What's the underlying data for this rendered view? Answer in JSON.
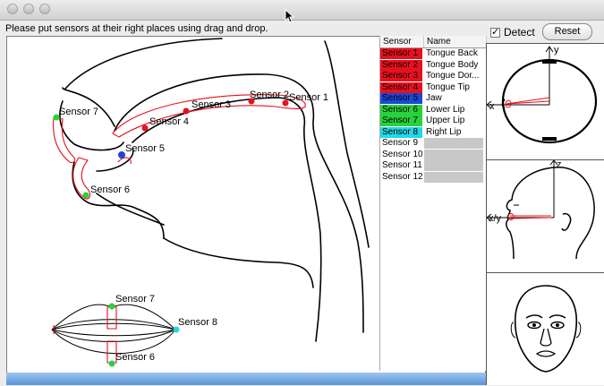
{
  "instruction": "Please put sensors at their right places using drag and drop.",
  "table": {
    "header_sensor": "Sensor",
    "header_name": "Name",
    "rows": [
      {
        "sensor": "Sensor 1",
        "name": "Tongue Back",
        "color": "#e8101e"
      },
      {
        "sensor": "Sensor 2",
        "name": "Tongue Body",
        "color": "#e8101e"
      },
      {
        "sensor": "Sensor 3",
        "name": "Tongue Dor...",
        "color": "#e8101e"
      },
      {
        "sensor": "Sensor 4",
        "name": "Tongue Tip",
        "color": "#e8101e"
      },
      {
        "sensor": "Sensor 5",
        "name": "Jaw",
        "color": "#1a49d6"
      },
      {
        "sensor": "Sensor 6",
        "name": "Lower Lip",
        "color": "#28d23c"
      },
      {
        "sensor": "Sensor 7",
        "name": "Upper Lip",
        "color": "#28d23c"
      },
      {
        "sensor": "Sensor 8",
        "name": "Right Lip",
        "color": "#22d8e8"
      },
      {
        "sensor": "Sensor 9",
        "name": "",
        "color": ""
      },
      {
        "sensor": "Sensor 10",
        "name": "",
        "color": ""
      },
      {
        "sensor": "Sensor 11",
        "name": "",
        "color": ""
      },
      {
        "sensor": "Sensor 12",
        "name": "",
        "color": ""
      }
    ]
  },
  "detect": {
    "label": "Detect",
    "checked": true
  },
  "reset_label": "Reset",
  "sagittal_labels": {
    "s1": "Sensor 1",
    "s2": "Sensor 2",
    "s3": "Sensor 3",
    "s4": "Sensor 4",
    "s5": "Sensor 5",
    "s6": "Sensor 6",
    "s7": "Sensor 7"
  },
  "lips_labels": {
    "s7": "Sensor 7",
    "s8": "Sensor 8",
    "s6": "Sensor 6"
  },
  "axes": {
    "top_y": "y",
    "top_x": "x",
    "side_z": "z",
    "side_xy": "x/y"
  },
  "colors": {
    "tongue": "#e8101e",
    "jaw": "#1a49d6",
    "lip": "#28d23c",
    "corner": "#22d8e8"
  }
}
